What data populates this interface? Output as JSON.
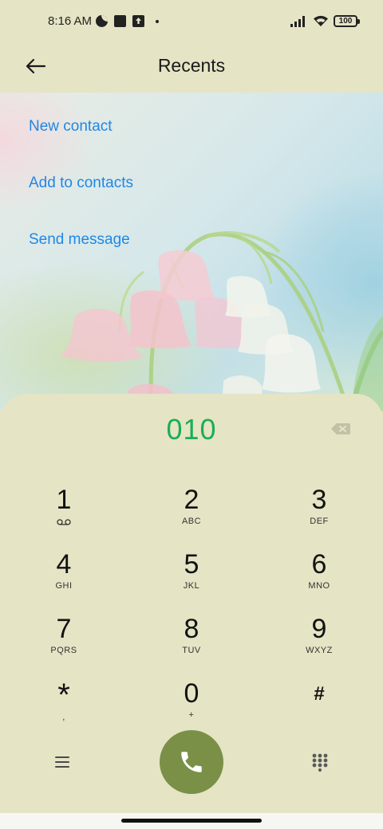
{
  "status_bar": {
    "time": "8:16 AM",
    "battery": "100",
    "icons": [
      "app-status-icon",
      "square-status-icon",
      "upload-icon",
      "dot-icon",
      "signal-icon",
      "wifi-icon",
      "battery-icon"
    ]
  },
  "header": {
    "title": "Recents",
    "back_icon": "arrow-left-icon"
  },
  "actions": [
    {
      "label": "New contact"
    },
    {
      "label": "Add to contacts"
    },
    {
      "label": "Send message"
    }
  ],
  "dialer": {
    "number": "010",
    "keys": [
      {
        "digit": "1",
        "letters": ""
      },
      {
        "digit": "2",
        "letters": "ABC"
      },
      {
        "digit": "3",
        "letters": "DEF"
      },
      {
        "digit": "4",
        "letters": "GHI"
      },
      {
        "digit": "5",
        "letters": "JKL"
      },
      {
        "digit": "6",
        "letters": "MNO"
      },
      {
        "digit": "7",
        "letters": "PQRS"
      },
      {
        "digit": "8",
        "letters": "TUV"
      },
      {
        "digit": "9",
        "letters": "WXYZ"
      },
      {
        "digit": "*",
        "letters": ","
      },
      {
        "digit": "0",
        "letters": "+"
      },
      {
        "digit": "#",
        "letters": ""
      }
    ]
  },
  "colors": {
    "background": "#e5e4c5",
    "link": "#1f87e6",
    "number": "#1aae52",
    "call_button": "#7a9046"
  }
}
